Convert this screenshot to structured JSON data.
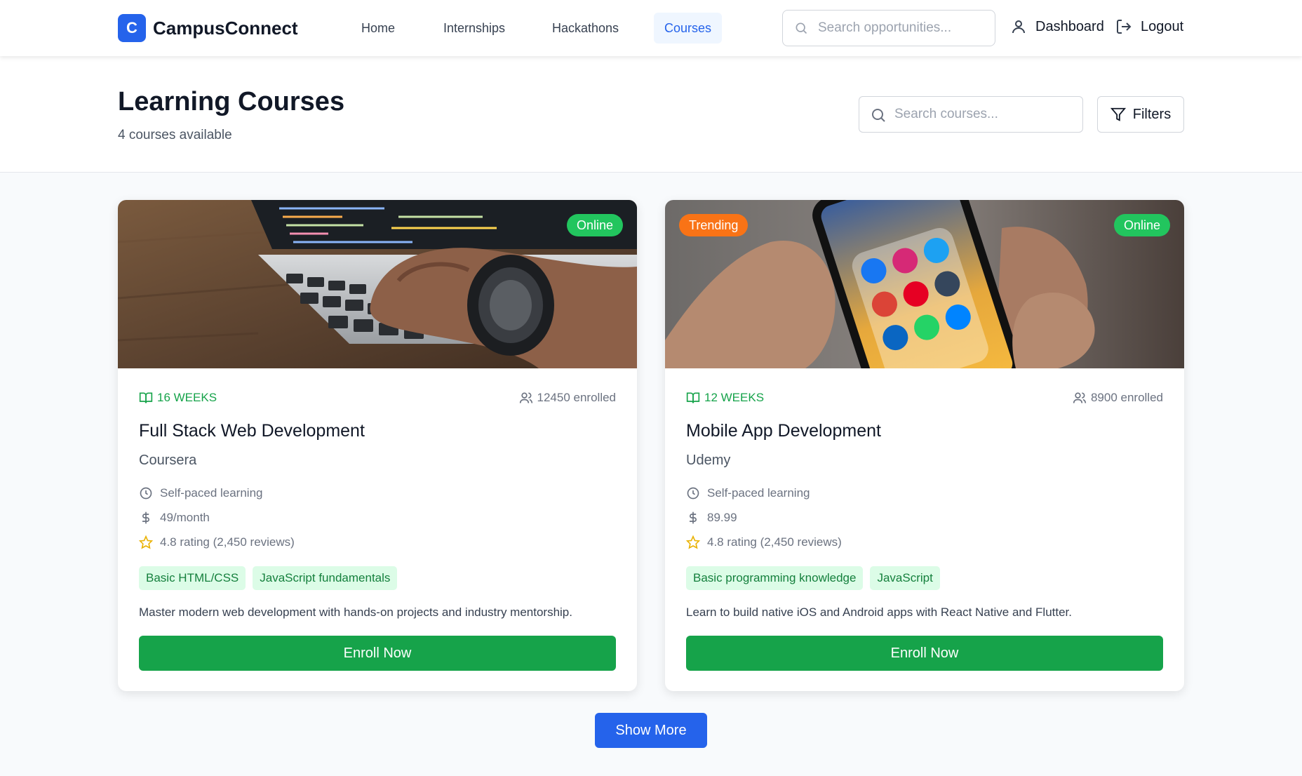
{
  "nav": {
    "logo_letter": "C",
    "brand": "CampusConnect",
    "links": [
      {
        "label": "Home"
      },
      {
        "label": "Internships"
      },
      {
        "label": "Hackathons"
      },
      {
        "label": "Courses",
        "active": true
      }
    ],
    "search_placeholder": "Search opportunities...",
    "dashboard_label": "Dashboard",
    "logout_label": "Logout"
  },
  "header": {
    "title": "Learning Courses",
    "subtitle": "4 courses available",
    "search_placeholder": "Search courses...",
    "filters_label": "Filters"
  },
  "courses": [
    {
      "badges": [
        "Online"
      ],
      "duration": "16 WEEKS",
      "enrolled": "12450 enrolled",
      "title": "Full Stack Web Development",
      "provider": "Coursera",
      "pace": "Self-paced learning",
      "price": "49/month",
      "rating": "4.8 rating (2,450 reviews)",
      "tags": [
        "Basic HTML/CSS",
        "JavaScript fundamentals"
      ],
      "description": "Master modern web development with hands-on projects and industry mentorship.",
      "button": "Enroll Now"
    },
    {
      "badges": [
        "Trending",
        "Online"
      ],
      "duration": "12 WEEKS",
      "enrolled": "8900 enrolled",
      "title": "Mobile App Development",
      "provider": "Udemy",
      "pace": "Self-paced learning",
      "price": "89.99",
      "rating": "4.8 rating (2,450 reviews)",
      "tags": [
        "Basic programming knowledge",
        "JavaScript"
      ],
      "description": "Learn to build native iOS and Android apps with React Native and Flutter.",
      "button": "Enroll Now"
    }
  ],
  "show_more_label": "Show More",
  "colors": {
    "primary": "#2563eb",
    "success": "#16a34a",
    "online_badge": "#22c55e",
    "trending_badge": "#f97316",
    "tag_bg": "#dcfce7"
  },
  "icons": [
    "search-icon",
    "user-icon",
    "logout-icon",
    "filter-icon",
    "book-open-icon",
    "users-icon",
    "clock-icon",
    "dollar-icon",
    "star-icon"
  ]
}
